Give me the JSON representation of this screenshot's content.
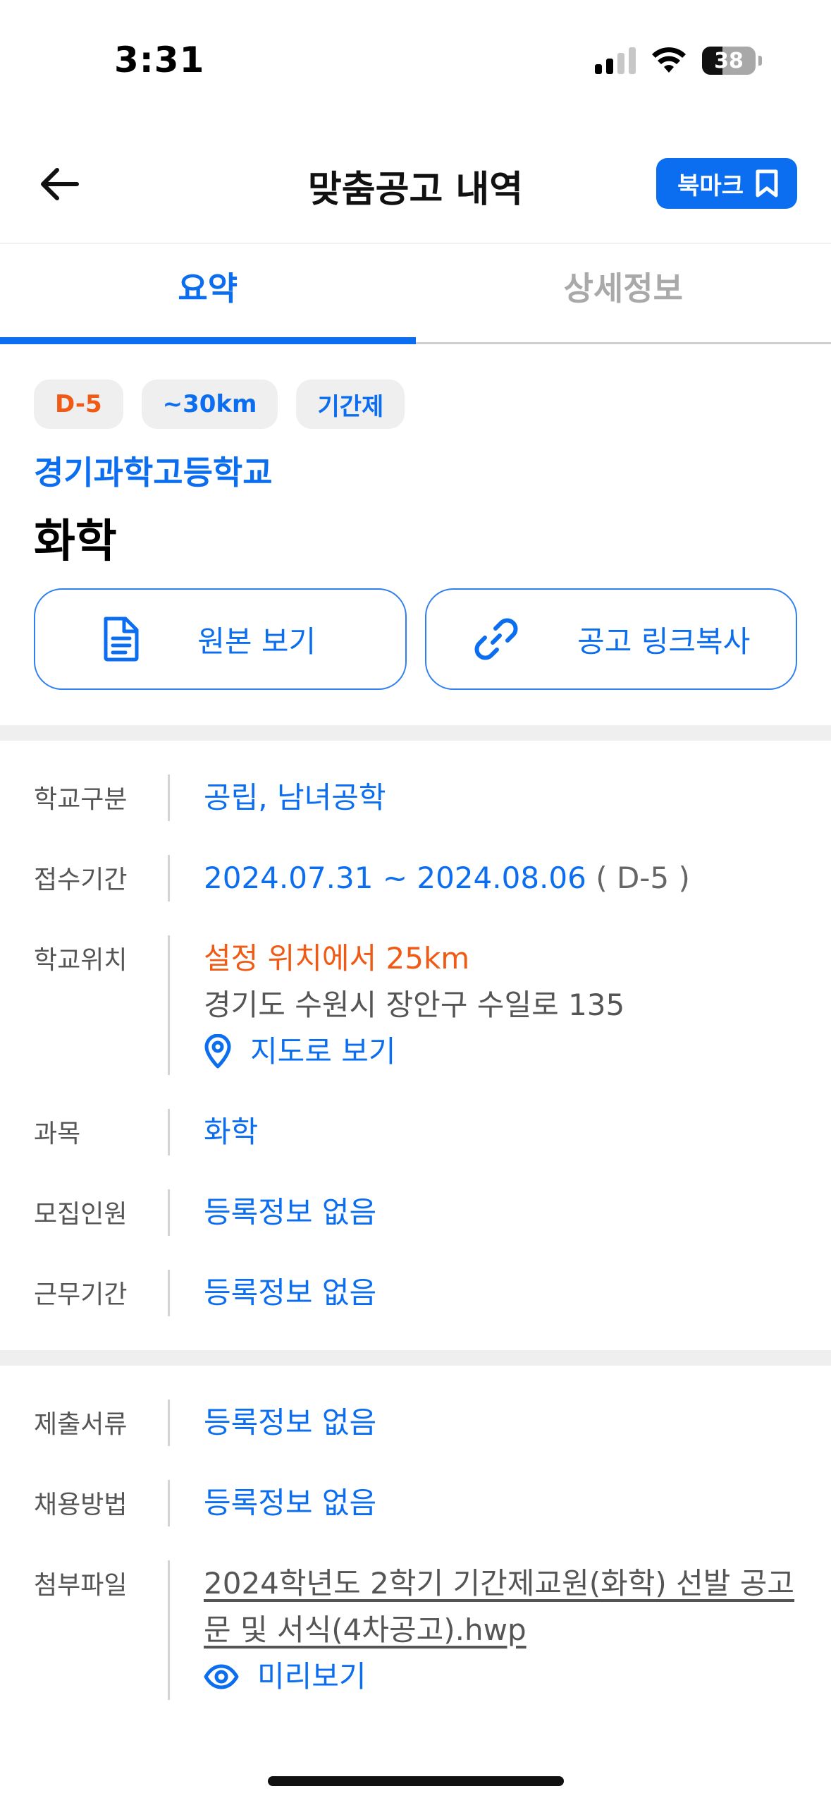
{
  "status_bar": {
    "time": "3:31",
    "battery_level": "38",
    "battery_percent": 38
  },
  "header": {
    "title": "맞춤공고 내역",
    "bookmark_label": "북마크",
    "back_icon": "arrow-left-icon",
    "bookmark_icon": "bookmark-icon"
  },
  "tabs": [
    {
      "label": "요약",
      "active": true
    },
    {
      "label": "상세정보",
      "active": false
    }
  ],
  "summary": {
    "badges": [
      "D-5",
      "~30km",
      "기간제"
    ],
    "school_name": "경기과학고등학교",
    "subject": "화학",
    "view_original_label": "원본 보기",
    "copy_link_label": "공고 링크복사"
  },
  "info": {
    "school_type": {
      "label": "학교구분",
      "value": "공립, 남녀공학"
    },
    "application_period": {
      "label": "접수기간",
      "value": "2024.07.31 ~ 2024.08.06",
      "d_day": "( D-5 )"
    },
    "school_location": {
      "label": "학교위치",
      "distance": "설정 위치에서 25km",
      "address": "경기도 수원시 장안구 수일로 135",
      "map_label": "지도로 보기"
    },
    "subject": {
      "label": "과목",
      "value": "화학"
    },
    "recruit_count": {
      "label": "모집인원",
      "value": "등록정보 없음"
    },
    "work_period": {
      "label": "근무기간",
      "value": "등록정보 없음"
    }
  },
  "extra": {
    "documents": {
      "label": "제출서류",
      "value": "등록정보 없음"
    },
    "hiring_method": {
      "label": "채용방법",
      "value": "등록정보 없음"
    },
    "attachment": {
      "label": "첨부파일",
      "file_name": "2024학년도 2학기 기간제교원(화학) 선발 공고문 및 서식(4차공고).hwp",
      "preview_label": "미리보기"
    }
  },
  "colors": {
    "accent": "#0b6ef0",
    "warning": "#f05a14",
    "divider": "#efefef"
  }
}
